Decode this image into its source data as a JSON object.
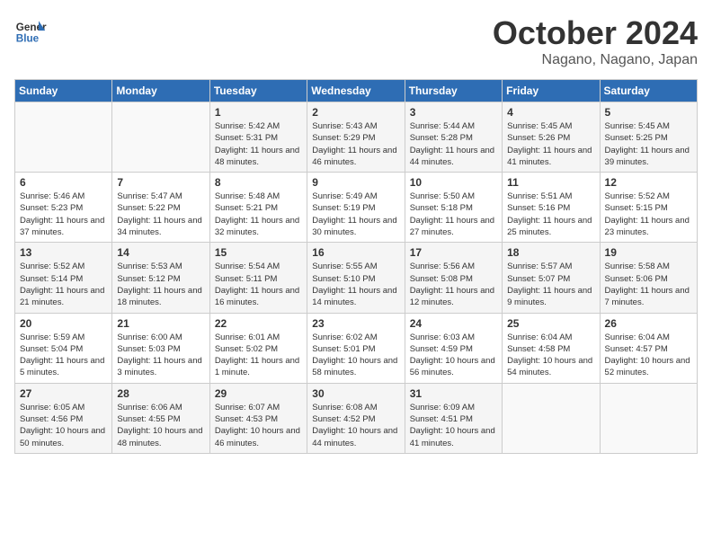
{
  "header": {
    "logo_line1": "General",
    "logo_line2": "Blue",
    "month": "October 2024",
    "location": "Nagano, Nagano, Japan"
  },
  "weekdays": [
    "Sunday",
    "Monday",
    "Tuesday",
    "Wednesday",
    "Thursday",
    "Friday",
    "Saturday"
  ],
  "weeks": [
    [
      {
        "day": "",
        "sunrise": "",
        "sunset": "",
        "daylight": ""
      },
      {
        "day": "",
        "sunrise": "",
        "sunset": "",
        "daylight": ""
      },
      {
        "day": "1",
        "sunrise": "Sunrise: 5:42 AM",
        "sunset": "Sunset: 5:31 PM",
        "daylight": "Daylight: 11 hours and 48 minutes."
      },
      {
        "day": "2",
        "sunrise": "Sunrise: 5:43 AM",
        "sunset": "Sunset: 5:29 PM",
        "daylight": "Daylight: 11 hours and 46 minutes."
      },
      {
        "day": "3",
        "sunrise": "Sunrise: 5:44 AM",
        "sunset": "Sunset: 5:28 PM",
        "daylight": "Daylight: 11 hours and 44 minutes."
      },
      {
        "day": "4",
        "sunrise": "Sunrise: 5:45 AM",
        "sunset": "Sunset: 5:26 PM",
        "daylight": "Daylight: 11 hours and 41 minutes."
      },
      {
        "day": "5",
        "sunrise": "Sunrise: 5:45 AM",
        "sunset": "Sunset: 5:25 PM",
        "daylight": "Daylight: 11 hours and 39 minutes."
      }
    ],
    [
      {
        "day": "6",
        "sunrise": "Sunrise: 5:46 AM",
        "sunset": "Sunset: 5:23 PM",
        "daylight": "Daylight: 11 hours and 37 minutes."
      },
      {
        "day": "7",
        "sunrise": "Sunrise: 5:47 AM",
        "sunset": "Sunset: 5:22 PM",
        "daylight": "Daylight: 11 hours and 34 minutes."
      },
      {
        "day": "8",
        "sunrise": "Sunrise: 5:48 AM",
        "sunset": "Sunset: 5:21 PM",
        "daylight": "Daylight: 11 hours and 32 minutes."
      },
      {
        "day": "9",
        "sunrise": "Sunrise: 5:49 AM",
        "sunset": "Sunset: 5:19 PM",
        "daylight": "Daylight: 11 hours and 30 minutes."
      },
      {
        "day": "10",
        "sunrise": "Sunrise: 5:50 AM",
        "sunset": "Sunset: 5:18 PM",
        "daylight": "Daylight: 11 hours and 27 minutes."
      },
      {
        "day": "11",
        "sunrise": "Sunrise: 5:51 AM",
        "sunset": "Sunset: 5:16 PM",
        "daylight": "Daylight: 11 hours and 25 minutes."
      },
      {
        "day": "12",
        "sunrise": "Sunrise: 5:52 AM",
        "sunset": "Sunset: 5:15 PM",
        "daylight": "Daylight: 11 hours and 23 minutes."
      }
    ],
    [
      {
        "day": "13",
        "sunrise": "Sunrise: 5:52 AM",
        "sunset": "Sunset: 5:14 PM",
        "daylight": "Daylight: 11 hours and 21 minutes."
      },
      {
        "day": "14",
        "sunrise": "Sunrise: 5:53 AM",
        "sunset": "Sunset: 5:12 PM",
        "daylight": "Daylight: 11 hours and 18 minutes."
      },
      {
        "day": "15",
        "sunrise": "Sunrise: 5:54 AM",
        "sunset": "Sunset: 5:11 PM",
        "daylight": "Daylight: 11 hours and 16 minutes."
      },
      {
        "day": "16",
        "sunrise": "Sunrise: 5:55 AM",
        "sunset": "Sunset: 5:10 PM",
        "daylight": "Daylight: 11 hours and 14 minutes."
      },
      {
        "day": "17",
        "sunrise": "Sunrise: 5:56 AM",
        "sunset": "Sunset: 5:08 PM",
        "daylight": "Daylight: 11 hours and 12 minutes."
      },
      {
        "day": "18",
        "sunrise": "Sunrise: 5:57 AM",
        "sunset": "Sunset: 5:07 PM",
        "daylight": "Daylight: 11 hours and 9 minutes."
      },
      {
        "day": "19",
        "sunrise": "Sunrise: 5:58 AM",
        "sunset": "Sunset: 5:06 PM",
        "daylight": "Daylight: 11 hours and 7 minutes."
      }
    ],
    [
      {
        "day": "20",
        "sunrise": "Sunrise: 5:59 AM",
        "sunset": "Sunset: 5:04 PM",
        "daylight": "Daylight: 11 hours and 5 minutes."
      },
      {
        "day": "21",
        "sunrise": "Sunrise: 6:00 AM",
        "sunset": "Sunset: 5:03 PM",
        "daylight": "Daylight: 11 hours and 3 minutes."
      },
      {
        "day": "22",
        "sunrise": "Sunrise: 6:01 AM",
        "sunset": "Sunset: 5:02 PM",
        "daylight": "Daylight: 11 hours and 1 minute."
      },
      {
        "day": "23",
        "sunrise": "Sunrise: 6:02 AM",
        "sunset": "Sunset: 5:01 PM",
        "daylight": "Daylight: 10 hours and 58 minutes."
      },
      {
        "day": "24",
        "sunrise": "Sunrise: 6:03 AM",
        "sunset": "Sunset: 4:59 PM",
        "daylight": "Daylight: 10 hours and 56 minutes."
      },
      {
        "day": "25",
        "sunrise": "Sunrise: 6:04 AM",
        "sunset": "Sunset: 4:58 PM",
        "daylight": "Daylight: 10 hours and 54 minutes."
      },
      {
        "day": "26",
        "sunrise": "Sunrise: 6:04 AM",
        "sunset": "Sunset: 4:57 PM",
        "daylight": "Daylight: 10 hours and 52 minutes."
      }
    ],
    [
      {
        "day": "27",
        "sunrise": "Sunrise: 6:05 AM",
        "sunset": "Sunset: 4:56 PM",
        "daylight": "Daylight: 10 hours and 50 minutes."
      },
      {
        "day": "28",
        "sunrise": "Sunrise: 6:06 AM",
        "sunset": "Sunset: 4:55 PM",
        "daylight": "Daylight: 10 hours and 48 minutes."
      },
      {
        "day": "29",
        "sunrise": "Sunrise: 6:07 AM",
        "sunset": "Sunset: 4:53 PM",
        "daylight": "Daylight: 10 hours and 46 minutes."
      },
      {
        "day": "30",
        "sunrise": "Sunrise: 6:08 AM",
        "sunset": "Sunset: 4:52 PM",
        "daylight": "Daylight: 10 hours and 44 minutes."
      },
      {
        "day": "31",
        "sunrise": "Sunrise: 6:09 AM",
        "sunset": "Sunset: 4:51 PM",
        "daylight": "Daylight: 10 hours and 41 minutes."
      },
      {
        "day": "",
        "sunrise": "",
        "sunset": "",
        "daylight": ""
      },
      {
        "day": "",
        "sunrise": "",
        "sunset": "",
        "daylight": ""
      }
    ]
  ]
}
